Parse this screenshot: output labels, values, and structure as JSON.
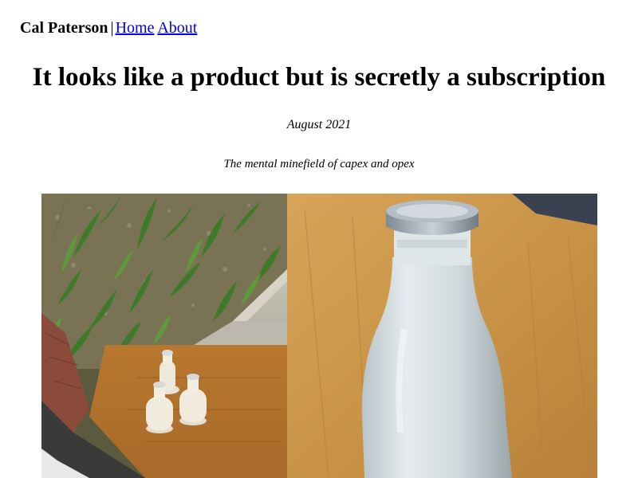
{
  "nav": {
    "site_name": "Cal Paterson",
    "separator": "|",
    "links": [
      {
        "label": "Home"
      },
      {
        "label": "About"
      }
    ]
  },
  "article": {
    "title": "It looks like a product but is secretly a subscription",
    "date": "August 2021",
    "subtitle": "The mental minefield of capex and opex",
    "hero_image": {
      "left_panel": "three-milk-bottles-on-doormat-photo",
      "right_panel": "glass-milk-bottle-on-table-photo"
    }
  },
  "colors": {
    "link": "#0000ee",
    "text": "#000000",
    "background": "#ffffff"
  }
}
